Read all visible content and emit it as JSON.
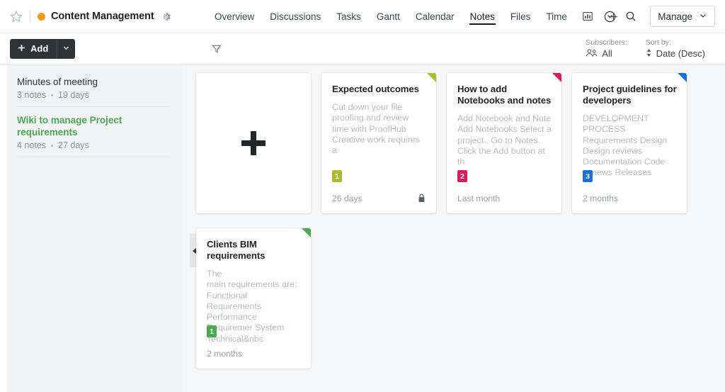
{
  "header": {
    "project_title": "Content Management",
    "project_color": "#f59a1b",
    "star_icon": "star-outline-icon",
    "gear_icon": "gear-icon",
    "nav": [
      {
        "label": "Overview",
        "active": false
      },
      {
        "label": "Discussions",
        "active": false
      },
      {
        "label": "Tasks",
        "active": false
      },
      {
        "label": "Gantt",
        "active": false
      },
      {
        "label": "Calendar",
        "active": false
      },
      {
        "label": "Notes",
        "active": true
      },
      {
        "label": "Files",
        "active": false
      },
      {
        "label": "Time",
        "active": false
      }
    ],
    "chart_icon": "bar-chart-icon",
    "add_tab_icon": "plus-icon",
    "activity_icon": "clock-circle-icon",
    "search_icon": "search-icon",
    "manage_label": "Manage",
    "manage_caret": "chevron-down-icon"
  },
  "toolbar": {
    "add_label": "Add",
    "add_plus_icon": "plus-icon",
    "add_caret_icon": "chevron-down-icon",
    "filter_icon": "filter-funnel-icon",
    "subscribers_label": "Subscribers:",
    "subscribers_value": "All",
    "subscribers_icon": "people-icon",
    "sort_label": "Sort by:",
    "sort_value": "Date (Desc)",
    "sort_icon": "sort-updown-icon"
  },
  "sidebar": {
    "notebooks": [
      {
        "title": "Minutes of meeting",
        "notes": "3 notes",
        "age": "19 days",
        "active": false
      },
      {
        "title": "Wiki to manage Project requirements",
        "notes": "4 notes",
        "age": "27 days",
        "active": true
      }
    ]
  },
  "main": {
    "add_note_icon": "plus-icon",
    "collapse_handle_icon": "triangle-left-icon",
    "cards": [
      {
        "title": "Expected outcomes",
        "body": "Cut down your file proofing and review time with ProofHub\nCreative work requires a",
        "badge": "1",
        "color": "#a9bd2e",
        "age": "26 days",
        "locked": true,
        "lock_icon": "lock-icon"
      },
      {
        "title": "How to add Notebooks and notes",
        "body": "Add Notebook and Note Add Notebooks Select a project.. Go to Notes. Click the Add button at th",
        "badge": "2",
        "color": "#d81b60",
        "age": "Last month",
        "locked": false,
        "lock_icon": ""
      },
      {
        "title": "Project guidelines for developers",
        "body": "DEVELOPMENT PROCESS  Requirements Design Design reviews Documentation Code reviews Releases",
        "badge": "3",
        "color": "#1b6fd8",
        "age": "2 months",
        "locked": false,
        "lock_icon": ""
      },
      {
        "title": "Clients BIM requirements",
        "body": "The\nmain requirements are:\nFunctional Requirements Performance Requiremer System Technical&nbs",
        "badge": "1",
        "color": "#4aa851",
        "age": "2 months",
        "locked": false,
        "lock_icon": ""
      }
    ]
  }
}
